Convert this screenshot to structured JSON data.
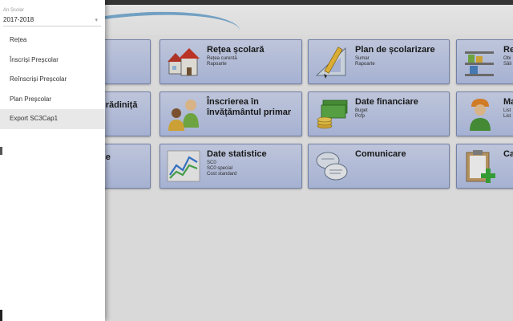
{
  "drawer": {
    "year_label": "An Școlar",
    "year_value": "2017-2018",
    "caret": "▾",
    "items": [
      {
        "label": "Rețea"
      },
      {
        "label": "Înscriși Preșcolar"
      },
      {
        "label": "Reînscriși Preșcolar"
      },
      {
        "label": "Plan Preșcolar"
      },
      {
        "label": "Export SC3Cap1"
      }
    ]
  },
  "tiles": {
    "partial_left_row2": "grădiniță",
    "partial_left_row3": "ne",
    "retea": {
      "title": "Rețea școlară",
      "subs": [
        "Rețea curentă",
        "Rapoarte"
      ]
    },
    "plan": {
      "title": "Plan de școlarizare",
      "subs": [
        "Sumar",
        "Rapoarte"
      ]
    },
    "res_partial": {
      "title": "Re",
      "subs": [
        "Obi",
        "Săli"
      ]
    },
    "inscriere": {
      "title_line1": "Înscrierea în",
      "title_line2": "învățământul primar"
    },
    "financiare": {
      "title": "Date financiare",
      "subs": [
        "Buget",
        "Pcfp"
      ]
    },
    "ma_partial": {
      "title": "Ma",
      "subs": [
        "List",
        "List"
      ]
    },
    "statistice": {
      "title": "Date statistice",
      "subs": [
        "SC0",
        "SC0 special",
        "Cost standard"
      ]
    },
    "comunicare": {
      "title": "Comunicare"
    },
    "cat_partial": {
      "title": "Cat"
    }
  },
  "colors": {
    "tile_top": "#d4dcf4",
    "tile_bottom": "#b9c6ea",
    "tile_border": "#7f8fb8",
    "drawer_active": "#e8e8e8"
  }
}
